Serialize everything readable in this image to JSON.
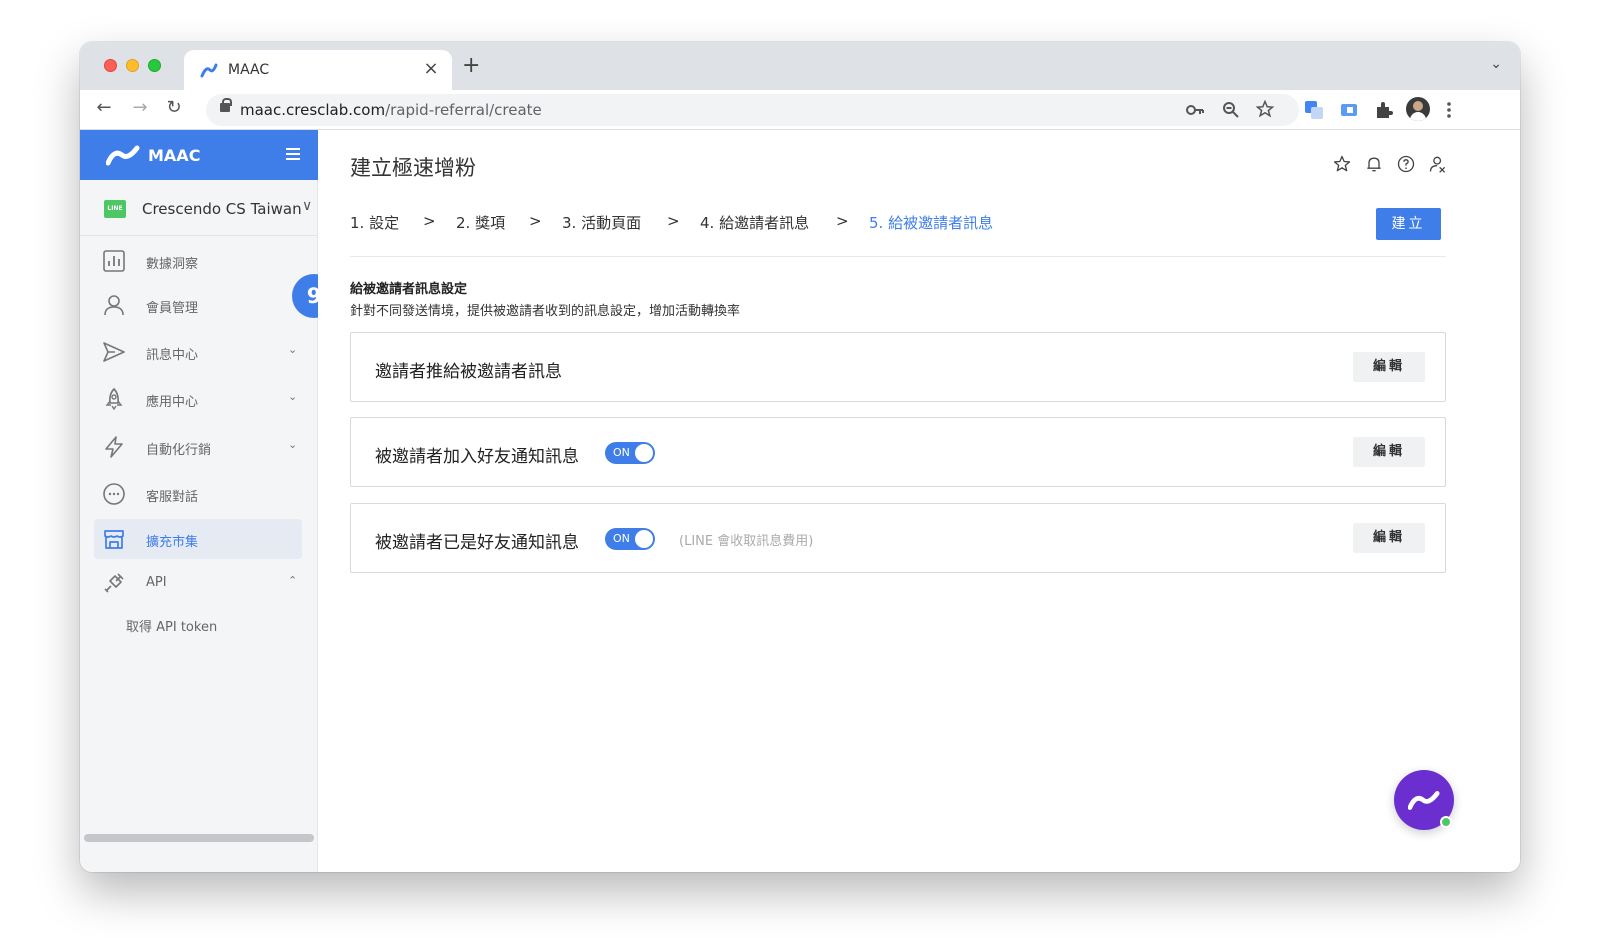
{
  "browser": {
    "tab_title": "MAAC",
    "tab_close": "×",
    "new_tab": "+",
    "tabs_menu": "⌄",
    "url_domain": "maac.cresclab.com",
    "url_path": "/rapid-referral/create",
    "back": "←",
    "forward": "→",
    "reload": "↻"
  },
  "sidebar": {
    "brand": "MAAC",
    "account_badge": "LINE",
    "account_name": "Crescendo CS Taiwan",
    "account_caret": "∨",
    "items": [
      {
        "label": "數據洞察",
        "icon": "chart-icon"
      },
      {
        "label": "會員管理",
        "icon": "user-icon"
      },
      {
        "label": "訊息中心",
        "icon": "send-icon",
        "caret": "⌄"
      },
      {
        "label": "應用中心",
        "icon": "rocket-icon",
        "caret": "⌄"
      },
      {
        "label": "自動化行銷",
        "icon": "lightning-icon",
        "caret": "⌄"
      },
      {
        "label": "客服對話",
        "icon": "chat-icon"
      },
      {
        "label": "擴充市集",
        "icon": "store-icon"
      },
      {
        "label": "API",
        "icon": "plug-icon",
        "caret": "⌃"
      }
    ],
    "sub_item": "取得 API token"
  },
  "tutorial_step": "9",
  "main": {
    "title": "建立極速增粉",
    "steps": [
      "1. 設定",
      "2. 獎項",
      "3. 活動頁面",
      "4. 給邀請者訊息",
      "5. 給被邀請者訊息"
    ],
    "step_separator": ">",
    "create_button": "建立",
    "section_title": "給被邀請者訊息設定",
    "section_desc": "針對不同發送情境，提供被邀請者收到的訊息設定，增加活動轉換率",
    "cards": [
      {
        "title": "邀請者推給被邀請者訊息",
        "edit": "編輯"
      },
      {
        "title": "被邀請者加入好友通知訊息",
        "toggle": "ON",
        "edit": "編輯"
      },
      {
        "title": "被邀請者已是好友通知訊息",
        "toggle": "ON",
        "note": "(LINE 會收取訊息費用)",
        "edit": "編輯"
      }
    ]
  },
  "colors": {
    "primary": "#3f7ee8",
    "chat_bubble": "#6b2fd0",
    "line_green": "#4cc764"
  }
}
